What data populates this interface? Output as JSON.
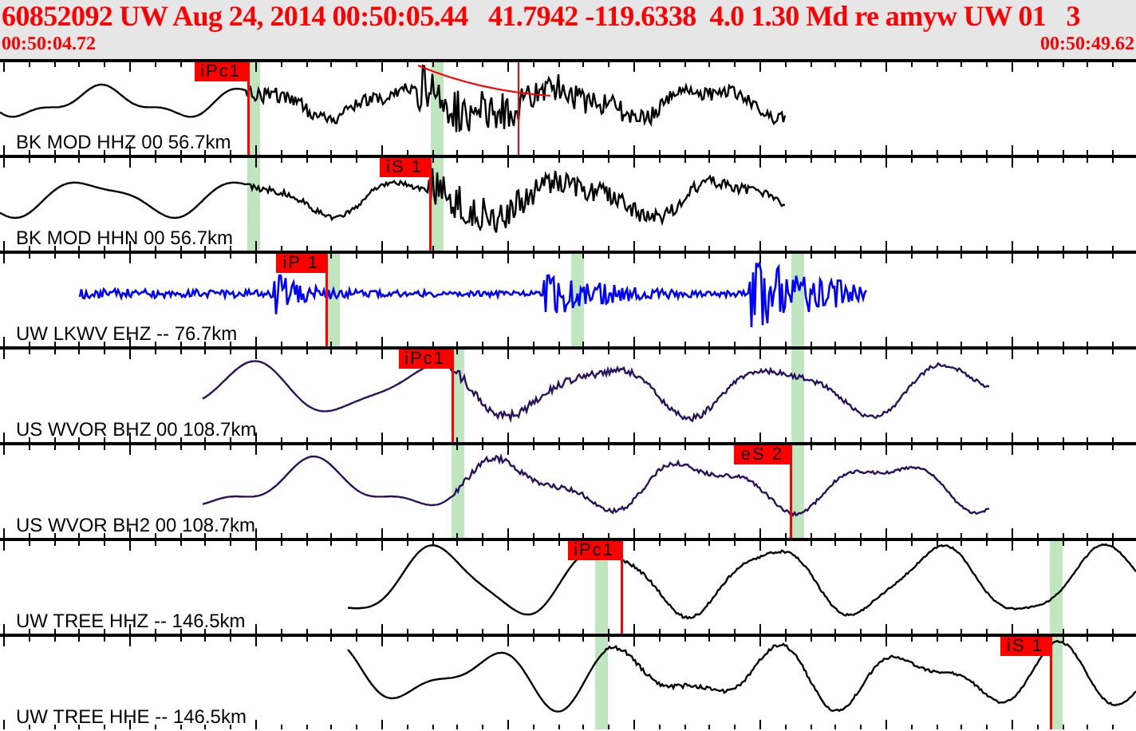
{
  "header": {
    "title": "60852092 UW Aug 24, 2014 00:50:05.44   41.7942 -119.6338  4.0 1.30 Md re amyw UW 01   3",
    "start_time": "00:50:04.72",
    "end_time": "00:50:49.62"
  },
  "traces": [
    {
      "label": "BK MOD HHZ 00 56.7km",
      "color": "#000000",
      "picks": [
        {
          "label": "iPc1"
        }
      ]
    },
    {
      "label": "BK MOD HHN 00 56.7km",
      "color": "#000000",
      "picks": [
        {
          "label": "iS 1"
        }
      ]
    },
    {
      "label": "UW LKWV EHZ -- 76.7km",
      "color": "#0000ff",
      "picks": [
        {
          "label": "iP 1"
        }
      ]
    },
    {
      "label": "US WVOR BHZ 00 108.7km",
      "color": "#2a1060",
      "picks": [
        {
          "label": "iPc1"
        }
      ]
    },
    {
      "label": "US WVOR BH2 00 108.7km",
      "color": "#2a1060",
      "picks": [
        {
          "label": "eS 2"
        }
      ]
    },
    {
      "label": "UW TREE HHZ -- 146.5km",
      "color": "#000000",
      "picks": [
        {
          "label": "iPc1"
        }
      ]
    },
    {
      "label": "UW TREE HHE -- 146.5km",
      "color": "#000000",
      "picks": [
        {
          "label": "iS 1"
        }
      ]
    }
  ]
}
